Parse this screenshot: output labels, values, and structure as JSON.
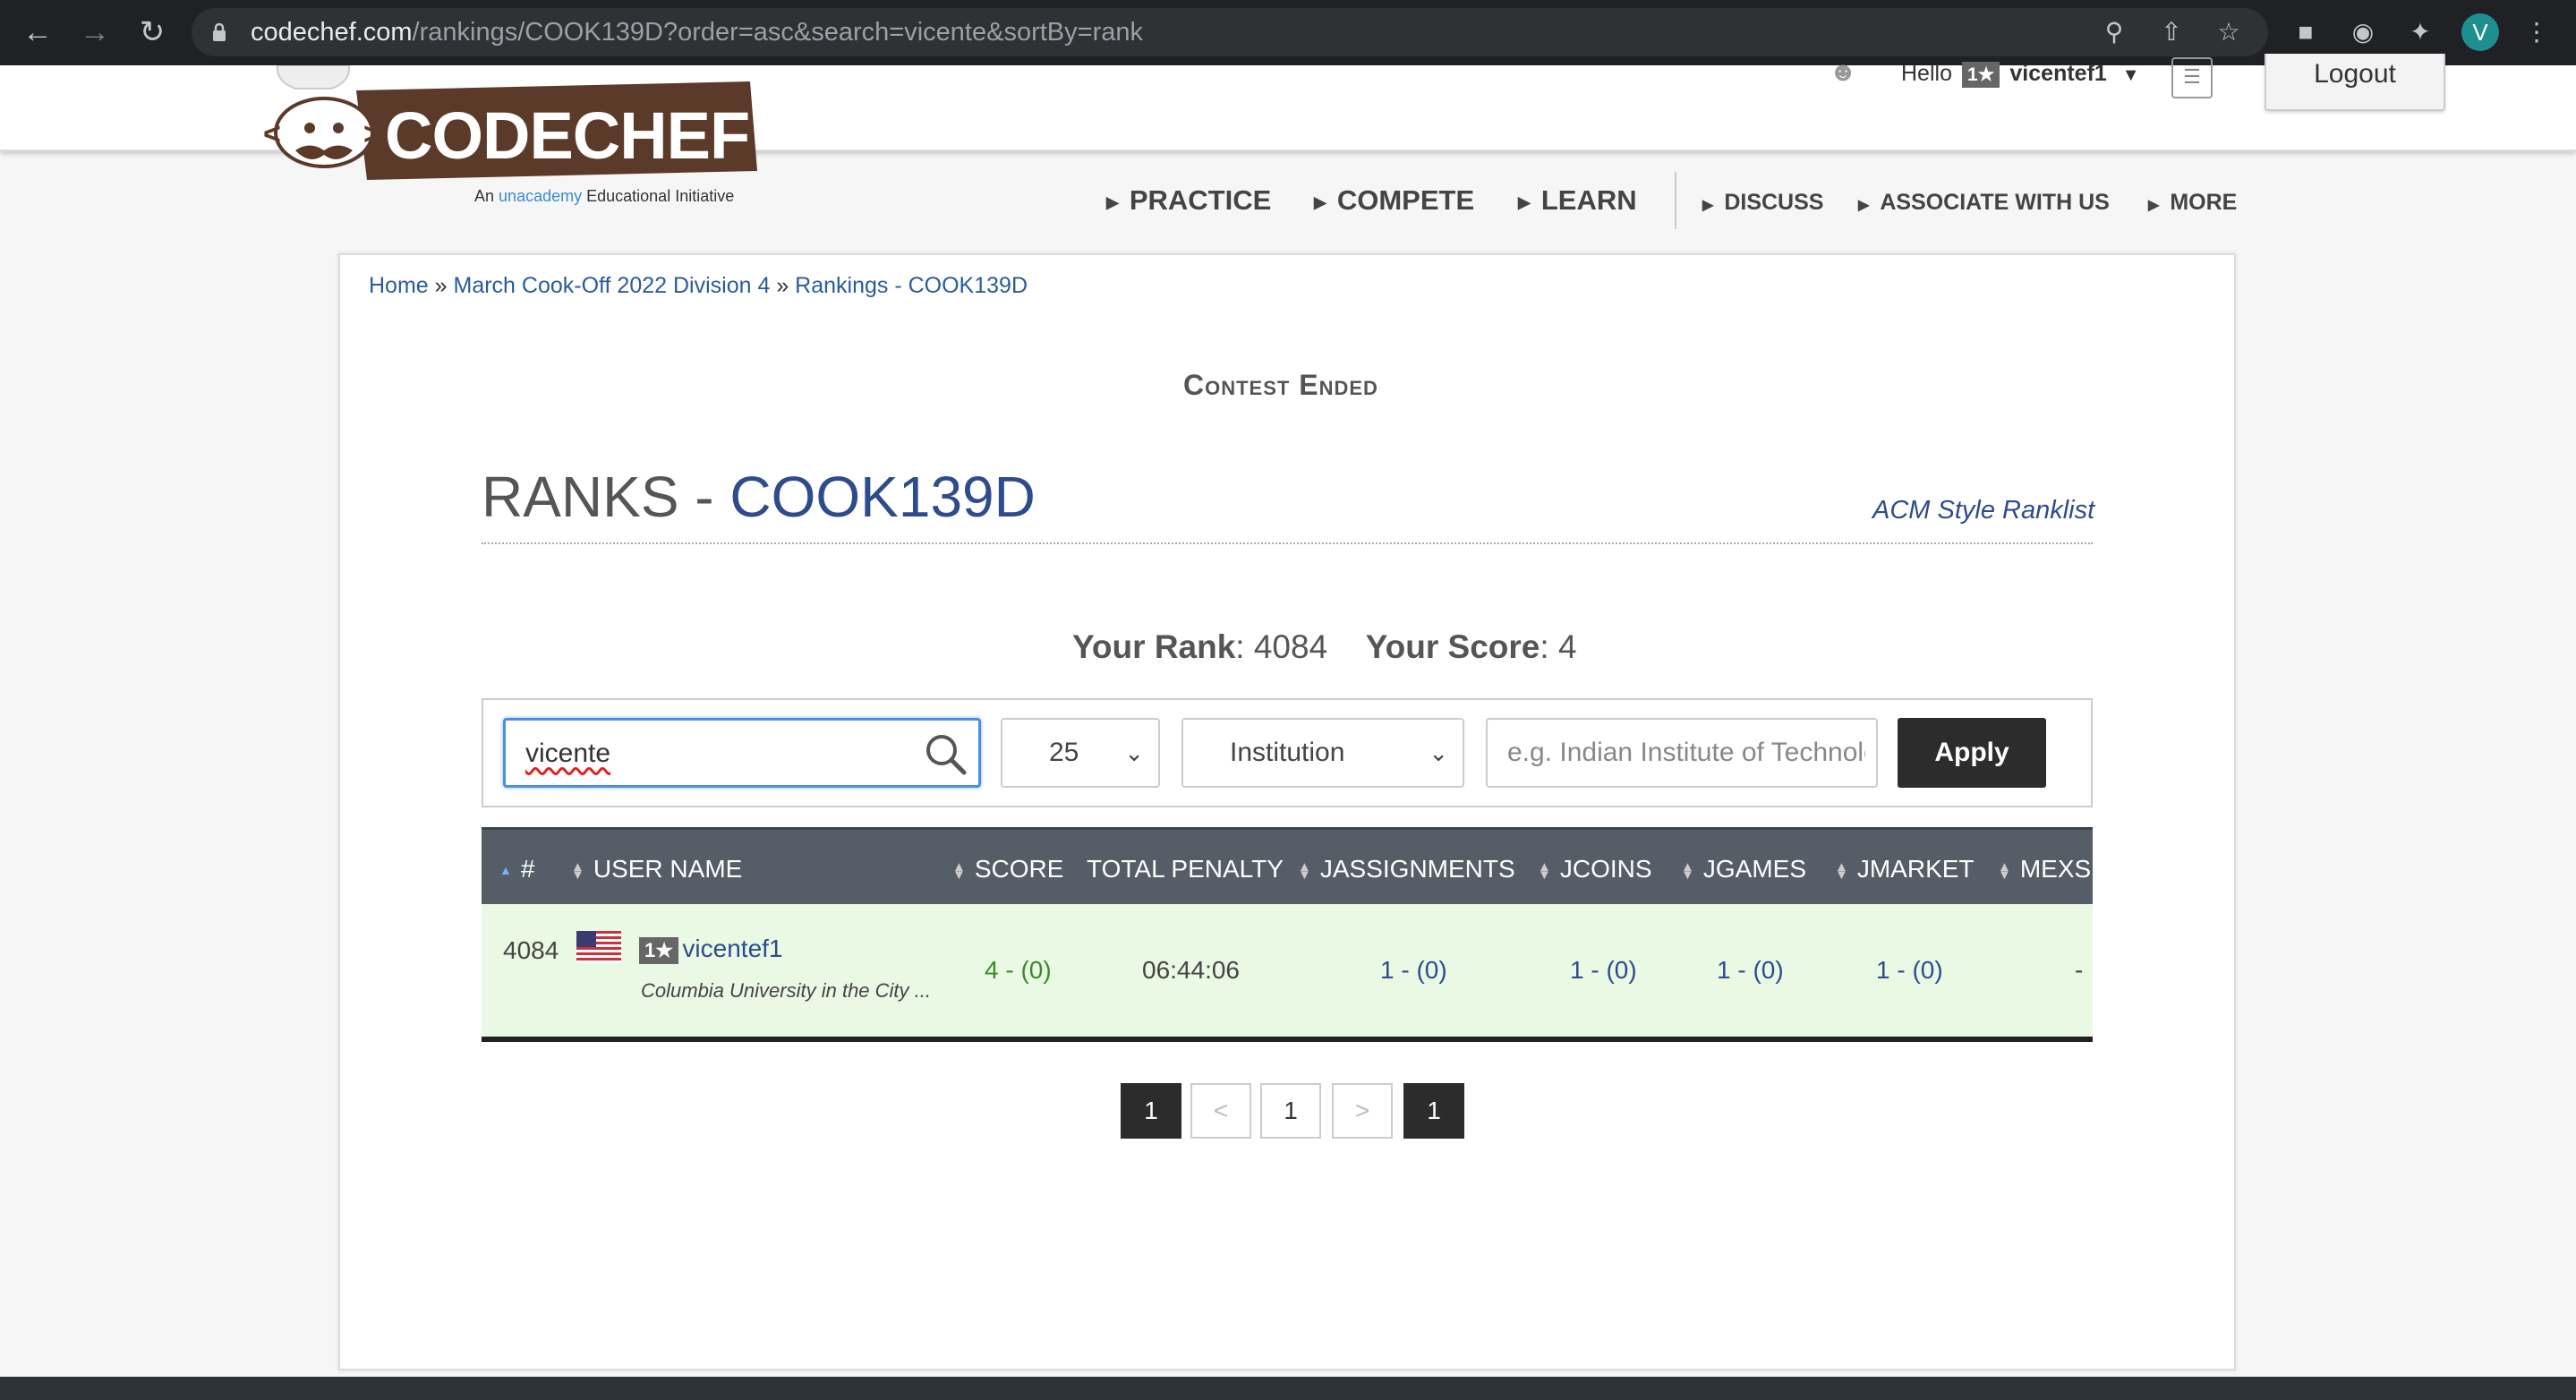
{
  "browser": {
    "url_host": "codechef.com",
    "url_path": "/rankings/COOK139D?order=asc&search=vicente&sortBy=rank",
    "profile_initial": "V"
  },
  "header": {
    "logo_text": "CODECHEF",
    "tagline_prefix": "An",
    "tagline_brand": "unacademy",
    "tagline_suffix": "Educational Initiative",
    "hello": "Hello",
    "user_stars": "1★",
    "username": "vicentef1",
    "logout": "Logout"
  },
  "nav": {
    "main": [
      "PRACTICE",
      "COMPETE",
      "LEARN"
    ],
    "sub": [
      "DISCUSS",
      "ASSOCIATE WITH US",
      "MORE"
    ]
  },
  "breadcrumb": {
    "home": "Home",
    "sep": "»",
    "contest": "March Cook-Off 2022 Division 4",
    "page": "Rankings - COOK139D"
  },
  "contest_status": "Contest Ended",
  "title": {
    "prefix": "RANKS - ",
    "code": "COOK139D",
    "acm_link": "ACM Style Ranklist"
  },
  "summary": {
    "rank_label": "Your Rank",
    "rank_value": "4084",
    "score_label": "Your Score",
    "score_value": "4"
  },
  "filters": {
    "search_value": "vicente",
    "page_size": "25",
    "filter_type": "Institution",
    "institution_placeholder": "e.g. Indian Institute of Technology",
    "apply": "Apply"
  },
  "table": {
    "columns": [
      "#",
      "USER NAME",
      "SCORE",
      "TOTAL PENALTY",
      "JASSIGNMENTS",
      "JCOINS",
      "JGAMES",
      "JMARKET",
      "MEXS"
    ],
    "rows": [
      {
        "rank": "4084",
        "stars": "1★",
        "username": "vicentef1",
        "institution": "Columbia University in the City ...",
        "score": "4 - (0)",
        "penalty": "06:44:06",
        "jassignments": "1 - (0)",
        "jcoins": "1 - (0)",
        "jgames": "1 - (0)",
        "jmarket": "1 - (0)",
        "mexs": "-"
      }
    ]
  },
  "pagination": {
    "first": "1",
    "prev": "<",
    "current": "1",
    "next": ">",
    "last": "1"
  },
  "colors": {
    "brand_brown": "#5b3a29",
    "link_blue": "#2e4c8c",
    "table_header": "#555d66",
    "row_highlight": "#e9f9e4",
    "score_green": "#3b8a2c"
  }
}
